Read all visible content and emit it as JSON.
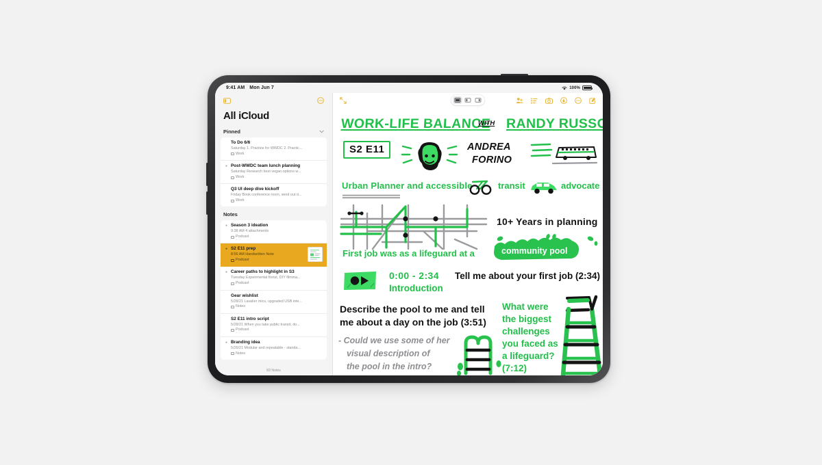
{
  "device": {
    "status_bar": {
      "time": "9:41 AM",
      "date": "Mon Jun 7",
      "battery": "100%",
      "battery_icon": "battery-full-icon",
      "wifi_icon": "wifi-icon"
    }
  },
  "sidebar": {
    "toggle_icon": "sidebar-toggle-icon",
    "more_icon": "more-circle-icon",
    "title": "All iCloud",
    "footer": "83 Notes",
    "groups": [
      {
        "label": "Pinned",
        "chevron_icon": "chevron-down-icon",
        "notes": [
          {
            "title": "To Do 6/6",
            "preview": "Saturday  1. Practice for WWDC 2. Practic...",
            "folder": "Work",
            "pinned": false,
            "selected": false,
            "has_thumb": false
          },
          {
            "title": "Post-WWDC team lunch planning",
            "preview": "Saturday  Research best vegan options w...",
            "folder": "Work",
            "pinned": true,
            "selected": false,
            "has_thumb": false
          },
          {
            "title": "Q3 UI deep dive kickoff",
            "preview": "Friday  Book conference room, send out d...",
            "folder": "Work",
            "pinned": false,
            "selected": false,
            "has_thumb": false
          }
        ]
      },
      {
        "label": "Notes",
        "chevron_icon": "",
        "notes": [
          {
            "title": "Season 3 ideation",
            "preview": "9:38 AM  4 attachments",
            "folder": "Podcast",
            "pinned": true,
            "selected": false,
            "has_thumb": false
          },
          {
            "title": "S2 E11 prep",
            "preview": "8:56 AM  Handwritten Note",
            "folder": "Podcast",
            "pinned": true,
            "selected": true,
            "has_thumb": true
          },
          {
            "title": "Career paths to highlight in S3",
            "preview": "Tuesday  Experimental florist, DIY filmma...",
            "folder": "Podcast",
            "pinned": true,
            "selected": false,
            "has_thumb": false
          },
          {
            "title": "Gear wishlist",
            "preview": "5/28/21  Lavalier mics, upgraded USB inte...",
            "folder": "Notes",
            "pinned": false,
            "selected": false,
            "has_thumb": false
          },
          {
            "title": "S2 E11 intro script",
            "preview": "5/28/21  When you take public transit, do...",
            "folder": "Podcast",
            "pinned": false,
            "selected": false,
            "has_thumb": false
          },
          {
            "title": "Branding idea",
            "preview": "5/26/21  Modular and repeatable - standa...",
            "folder": "Notes",
            "pinned": true,
            "selected": false,
            "has_thumb": false
          }
        ]
      }
    ]
  },
  "note_toolbar": {
    "expand_icon": "expand-arrows-icon",
    "layout_modes": [
      {
        "icon": "layout-full-icon",
        "active": true
      },
      {
        "icon": "layout-split-left-icon",
        "active": false
      },
      {
        "icon": "layout-slide-over-icon",
        "active": false
      }
    ],
    "right_icons": [
      "share-person-icon",
      "list-format-icon",
      "camera-icon",
      "markup-pen-icon",
      "more-circle-icon",
      "compose-icon"
    ]
  },
  "note_content": {
    "title_line": {
      "main": "WORK-LIFE BALANCE",
      "with": "WITH",
      "guest": "RANDY RUSSO"
    },
    "episode_badge": "S2 E11",
    "guest_name_line1": "ANDREA",
    "guest_name_line2": "FORINO",
    "role_line": "Urban Planner and accessible",
    "role_word_transit": "transit",
    "role_word_advocate": "advocate",
    "experience": "10+ Years in planning",
    "first_job_line": "First job was as a lifeguard at a",
    "highlight_pool": "community pool",
    "segment_time": "0:00 - 2:34",
    "segment_label": "Introduction",
    "question_1": "Tell me about your first job (2:34)",
    "question_2_line1": "Describe the pool to me and tell",
    "question_2_line2": "me about a day on the job (3:51)",
    "side_note_line1": "- Could we use some of her",
    "side_note_line2": "visual description of",
    "side_note_line3": "the pool in the intro?",
    "green_question": [
      "What were",
      "the biggest",
      "challenges",
      "you faced as",
      "a lifeguard?",
      "(7:12)"
    ],
    "icons": {
      "bicycle": "bicycle-icon",
      "car": "car-icon",
      "bus": "bus-icon",
      "face": "guest-portrait-icon",
      "map": "transit-map-icon",
      "play_badge": "play-button-icon",
      "ladder": "pool-ladder-icon",
      "lifeguard_chair": "lifeguard-chair-icon"
    }
  },
  "colors": {
    "green": "#22c04a",
    "ink": "#111111",
    "gray": "#8e8e93",
    "accent_yellow": "#e8a820",
    "toolbar_yellow": "#e8b93c"
  }
}
